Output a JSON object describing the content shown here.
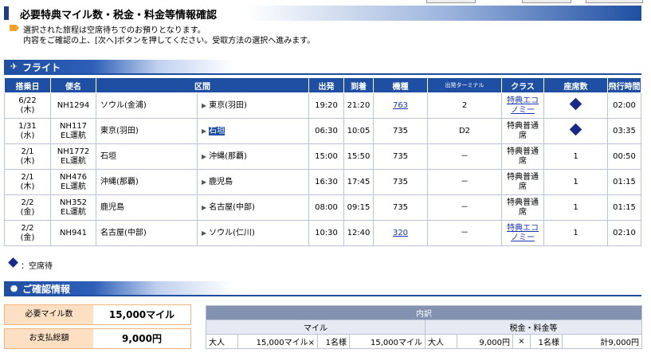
{
  "title": "必要特典マイル数・税金・料金等情報確認",
  "notice": {
    "line1": "選択された旅程は空席待ちでのお預りとなります。",
    "line2": "内容をご確認の上、[次へ]ボタンを押してください。受取方法の選択へ進みます。"
  },
  "flight_section": {
    "label": "フライト"
  },
  "table": {
    "headers": [
      "搭乗日",
      "便名",
      "区間",
      "出発",
      "到着",
      "機種",
      "出発ターミナル",
      "クラス",
      "座席数",
      "飛行時間"
    ],
    "rows": [
      {
        "date": "6/22",
        "dow": "(木)",
        "flight": "NH1294",
        "flight2": "",
        "from": "ソウル(金浦)",
        "to": "東京(羽田)",
        "dep": "19:20",
        "arr": "21:20",
        "equip": "763",
        "equip_link": true,
        "term": "2",
        "cls": "特典エコノミー",
        "cls_link": true,
        "seats": "",
        "waitlist": true,
        "time": "02:00",
        "to_hl": false
      },
      {
        "date": "1/31",
        "dow": "(水)",
        "flight": "NH117",
        "flight2": "EL運航",
        "from": "東京(羽田)",
        "to": "石垣",
        "dep": "06:30",
        "arr": "10:05",
        "equip": "735",
        "equip_link": false,
        "term": "D2",
        "cls": "特典普通席",
        "cls_link": false,
        "seats": "",
        "waitlist": true,
        "time": "03:35",
        "to_hl": true
      },
      {
        "date": "2/1",
        "dow": "(木)",
        "flight": "NH1772",
        "flight2": "EL運航",
        "from": "石垣",
        "to": "沖縄(那覇)",
        "dep": "15:00",
        "arr": "15:50",
        "equip": "735",
        "equip_link": false,
        "term": "－",
        "cls": "特典普通席",
        "cls_link": false,
        "seats": "1",
        "waitlist": false,
        "time": "00:50",
        "to_hl": false
      },
      {
        "date": "2/1",
        "dow": "(木)",
        "flight": "NH476",
        "flight2": "EL運航",
        "from": "沖縄(那覇)",
        "to": "鹿児島",
        "dep": "16:30",
        "arr": "17:45",
        "equip": "735",
        "equip_link": false,
        "term": "－",
        "cls": "特典普通席",
        "cls_link": false,
        "seats": "1",
        "waitlist": false,
        "time": "01:15",
        "to_hl": false
      },
      {
        "date": "2/2",
        "dow": "(金)",
        "flight": "NH352",
        "flight2": "EL運航",
        "from": "鹿児島",
        "to": "名古屋(中部)",
        "dep": "08:00",
        "arr": "09:15",
        "equip": "735",
        "equip_link": false,
        "term": "－",
        "cls": "特典普通席",
        "cls_link": false,
        "seats": "1",
        "waitlist": false,
        "time": "01:15",
        "to_hl": false
      },
      {
        "date": "2/2",
        "dow": "(金)",
        "flight": "NH941",
        "flight2": "",
        "from": "名古屋(中部)",
        "to": "ソウル(仁川)",
        "dep": "10:30",
        "arr": "12:40",
        "equip": "320",
        "equip_link": true,
        "term": "－",
        "cls": "特典エコノミー",
        "cls_link": true,
        "seats": "1",
        "waitlist": false,
        "time": "02:10",
        "to_hl": false
      }
    ]
  },
  "legend": {
    "waitlist": "：空席待"
  },
  "confirm_section": {
    "label": "ご確認情報"
  },
  "summary": {
    "miles_label": "必要マイル数",
    "miles_value": "15,000マイル",
    "pay_label": "お支払総額",
    "pay_value": "9,000円"
  },
  "breakdown": {
    "title": "内訳",
    "miles_header": "マイル",
    "tax_header": "税金・料金等",
    "row": {
      "pax1": "大人",
      "miles_each": "15,000マイル×",
      "count1": "1名様",
      "miles_total": "15,000マイル",
      "pax2": "大人",
      "tax_each": "9,000円",
      "times": "×",
      "count2": "1名様",
      "tax_total": "計9,000円"
    }
  },
  "colors": {
    "brand": "#1f4fa3",
    "accent": "#f3a327",
    "summary_label_bg": "#fde0c4"
  }
}
